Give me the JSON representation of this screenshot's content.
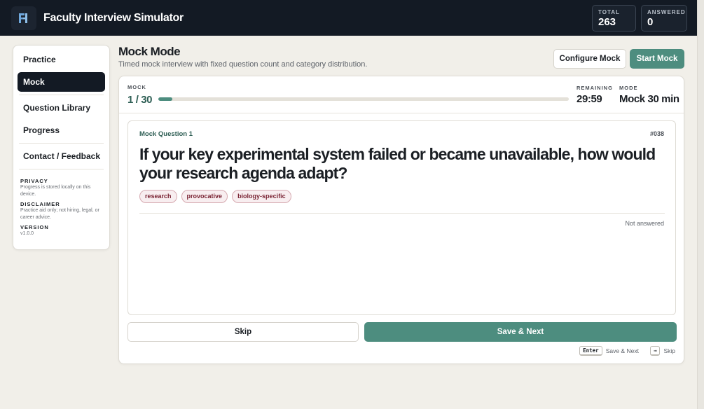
{
  "app": {
    "title": "Faculty Interview Simulator",
    "logo_icon": "faculty-monogram-icon",
    "stats": [
      {
        "label": "TOTAL",
        "value": "263"
      },
      {
        "label": "ANSWERED",
        "value": "0"
      }
    ]
  },
  "sidebar": {
    "items": [
      {
        "label": "Practice",
        "active": false
      },
      {
        "label": "Mock",
        "active": true
      },
      {
        "label": "Question Library",
        "active": false
      },
      {
        "label": "Progress",
        "active": false
      },
      {
        "label": "Contact / Feedback",
        "active": false
      }
    ],
    "meta": [
      {
        "label": "PRIVACY",
        "text": "Progress is stored locally on this device."
      },
      {
        "label": "DISCLAIMER",
        "text": "Practice aid only; not hiring, legal, or career advice."
      },
      {
        "label": "VERSION",
        "text": "v1.0.0"
      }
    ]
  },
  "page": {
    "title": "Mock Mode",
    "subtitle": "Timed mock interview with fixed question count and category distribution.",
    "configure_label": "Configure Mock",
    "start_label": "Start Mock"
  },
  "progress": {
    "mock_label": "MOCK",
    "mock_value": "1 / 30",
    "current": 1,
    "total": 30,
    "remaining_label": "REMAINING",
    "remaining_value": "29:59",
    "mode_label": "MODE",
    "mode_value": "Mock 30 min"
  },
  "question": {
    "label": "Mock Question 1",
    "id": "#038",
    "text": "If your key experimental system failed or became unavailable, how would your research agenda adapt?",
    "tags": [
      "research",
      "provocative",
      "biology-specific"
    ],
    "status": "Not answered"
  },
  "actions": {
    "skip_label": "Skip",
    "save_label": "Save & Next"
  },
  "shortcuts": [
    {
      "key": "Enter",
      "action": "Save & Next"
    },
    {
      "key": "→",
      "action": "Skip"
    }
  ],
  "colors": {
    "header_bg": "#131a24",
    "accent": "#4d8d7f",
    "tag_text": "#7a2434"
  }
}
